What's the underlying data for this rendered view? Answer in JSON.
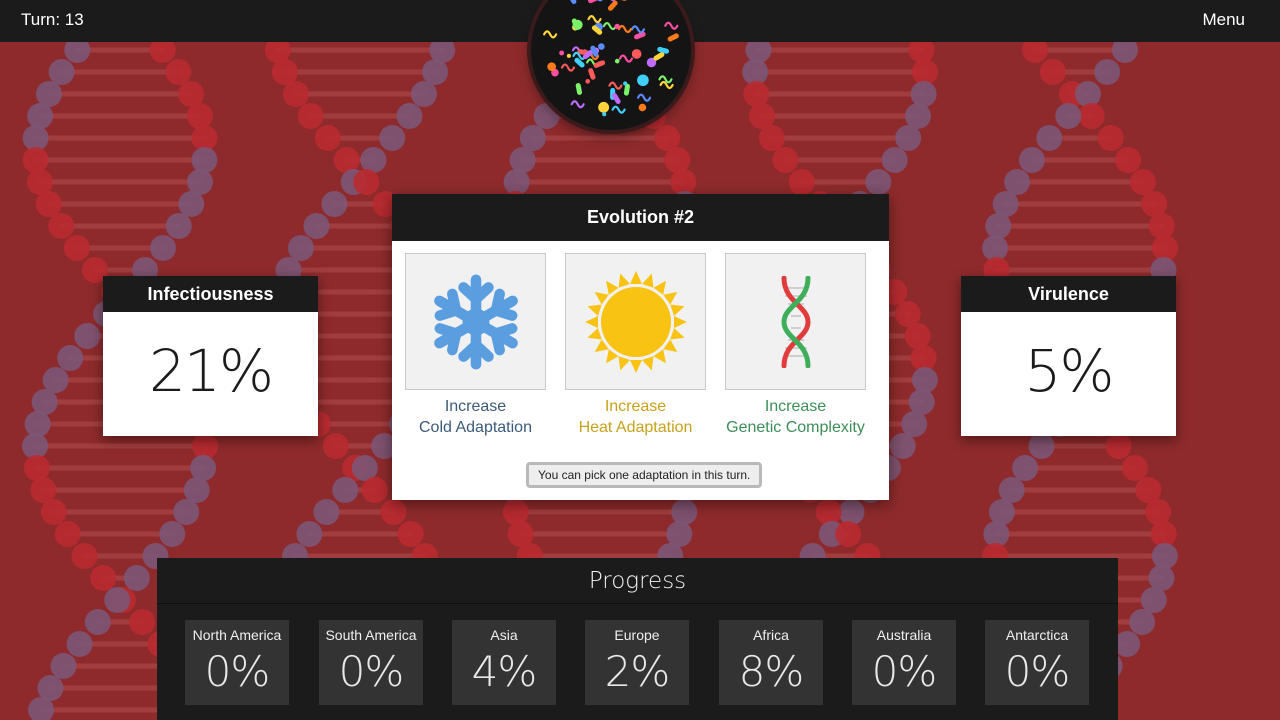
{
  "topbar": {
    "turn": "Turn: 13",
    "menu": "Menu"
  },
  "infectiousness": {
    "title": "Infectiousness",
    "value": "21%"
  },
  "virulence": {
    "title": "Virulence",
    "value": "5%"
  },
  "evolution": {
    "title": "Evolution #2",
    "options": [
      {
        "line1": "Increase",
        "line2": "Cold Adaptation",
        "icon": "snowflake-icon",
        "color": "#3c5b78"
      },
      {
        "line1": "Increase",
        "line2": "Heat Adaptation",
        "icon": "sun-icon",
        "color": "#c7a21b"
      },
      {
        "line1": "Increase",
        "line2": "Genetic Complexity",
        "icon": "dna-icon",
        "color": "#3c8f58"
      }
    ],
    "hint": "You can pick one adaptation in this turn."
  },
  "progress": {
    "title": "Progress",
    "regions": [
      {
        "name": "North America",
        "value": "0%"
      },
      {
        "name": "South America",
        "value": "0%"
      },
      {
        "name": "Asia",
        "value": "4%"
      },
      {
        "name": "Europe",
        "value": "2%"
      },
      {
        "name": "Africa",
        "value": "8%"
      },
      {
        "name": "Australia",
        "value": "0%"
      },
      {
        "name": "Antarctica",
        "value": "0%"
      }
    ]
  },
  "colors": {
    "background": "#8e2a2c",
    "panel": "#1b1b1b",
    "sun": "#f9c313",
    "snowflake": "#5b9ee0"
  }
}
